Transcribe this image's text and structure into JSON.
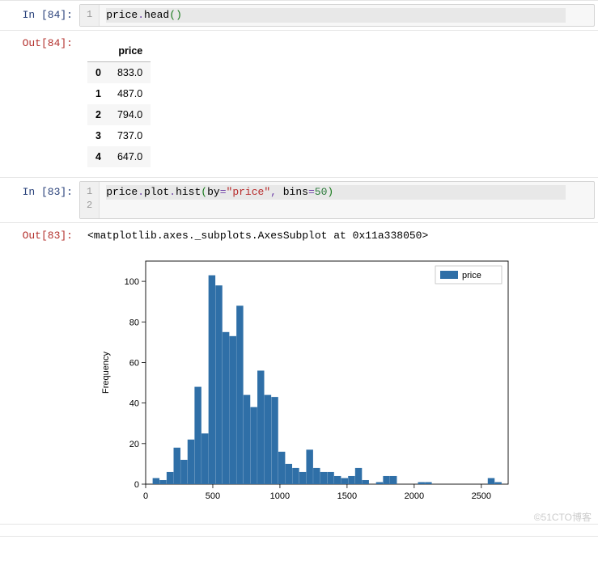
{
  "cells": [
    {
      "in_prompt": "In [84]:",
      "out_prompt": "Out[84]:",
      "code_lines": [
        "price.head()"
      ],
      "dataframe": {
        "columns": [
          "price"
        ],
        "index": [
          "0",
          "1",
          "2",
          "3",
          "4"
        ],
        "rows": [
          [
            "833.0"
          ],
          [
            "487.0"
          ],
          [
            "794.0"
          ],
          [
            "737.0"
          ],
          [
            "647.0"
          ]
        ]
      }
    },
    {
      "in_prompt": "In [83]:",
      "out_prompt": "Out[83]:",
      "code_lines": [
        "price.plot.hist(by=\"price\", bins=50)",
        ""
      ],
      "text_output": "<matplotlib.axes._subplots.AxesSubplot at 0x11a338050>"
    }
  ],
  "watermark": "©51CTO博客",
  "chart_data": {
    "type": "bar",
    "title": "",
    "xlabel": "",
    "ylabel": "Frequency",
    "legend": [
      "price"
    ],
    "legend_position": "top-right",
    "xlim": [
      0,
      2700
    ],
    "ylim": [
      0,
      110
    ],
    "xticks": [
      0,
      500,
      1000,
      1500,
      2000,
      2500
    ],
    "yticks": [
      0,
      20,
      40,
      60,
      80,
      100
    ],
    "bin_width": 52,
    "series": [
      {
        "name": "price",
        "color": "#2f6fa7",
        "x": [
          78,
          130,
          182,
          234,
          286,
          338,
          390,
          442,
          494,
          546,
          598,
          650,
          702,
          754,
          806,
          858,
          910,
          962,
          1014,
          1066,
          1118,
          1170,
          1222,
          1274,
          1326,
          1378,
          1430,
          1482,
          1534,
          1586,
          1638,
          1690,
          1742,
          1794,
          1846,
          1898,
          1950,
          2002,
          2054,
          2106,
          2158,
          2210,
          2262,
          2314,
          2366,
          2418,
          2470,
          2522,
          2574,
          2626
        ],
        "values": [
          3,
          2,
          6,
          18,
          12,
          22,
          48,
          25,
          103,
          98,
          75,
          73,
          88,
          44,
          38,
          56,
          44,
          43,
          16,
          10,
          8,
          6,
          17,
          8,
          6,
          6,
          4,
          3,
          4,
          8,
          2,
          0,
          1,
          4,
          4,
          0,
          0,
          0,
          1,
          1,
          0,
          0,
          0,
          0,
          0,
          0,
          0,
          0,
          3,
          1
        ]
      }
    ]
  }
}
